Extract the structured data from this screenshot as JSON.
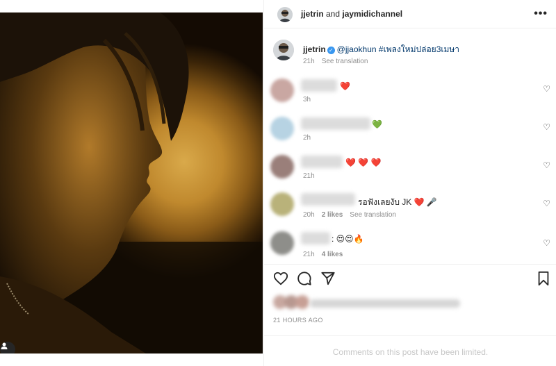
{
  "header": {
    "account1": "jjetrin",
    "connector": " and ",
    "account2": "jaymidichannel"
  },
  "caption": {
    "username": "jjetrin",
    "mention": "@jjaokhun",
    "hashtag": "#เพลงใหม่ปล่อย3เมษา",
    "time": "21h",
    "see_translation": "See translation"
  },
  "comments": [
    {
      "emoji": "❤️",
      "time": "3h",
      "emoji_color": "#ed1c34"
    },
    {
      "emoji": "💚",
      "time": "2h",
      "emoji_color": "#1fbf55"
    },
    {
      "emoji": "❤️ ❤️ ❤️",
      "time": "21h",
      "emoji_color": "#ed1c34"
    },
    {
      "text": "รอฟังเลยงับ JK",
      "emoji": "❤️ 🎤",
      "time": "20h",
      "likes": "2 likes",
      "see_translation": "See translation"
    },
    {
      "emoji": ": 😍😍🔥",
      "time": "21h",
      "likes": "4 likes"
    }
  ],
  "post": {
    "time_ago": "21 HOURS AGO",
    "limited_notice": "Comments on this post have been limited."
  },
  "icons": {
    "more": "more-options-icon",
    "like": "heart-outline-icon",
    "comment": "comment-icon",
    "share": "share-paper-plane-icon",
    "save": "bookmark-icon",
    "tags": "user-tag-icon",
    "verified": "verified-badge-icon"
  },
  "colors": {
    "link": "#00376b",
    "meta": "#8e8e8e",
    "verified": "#3897f0"
  }
}
